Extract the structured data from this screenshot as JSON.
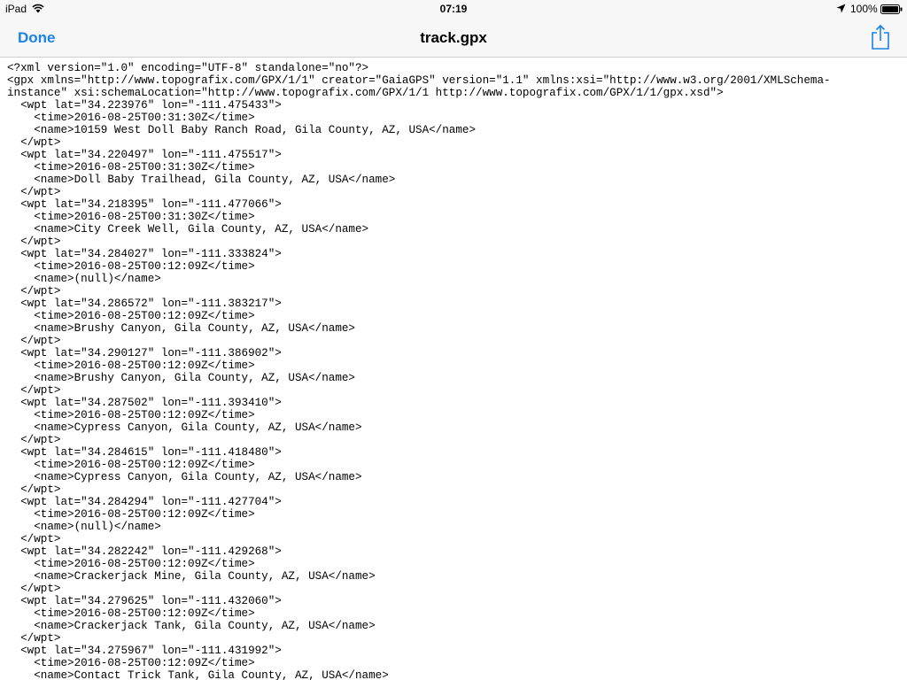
{
  "status_bar": {
    "carrier": "iPad",
    "time": "07:19",
    "battery": "100%"
  },
  "nav": {
    "done_label": "Done",
    "title": "track.gpx"
  },
  "icons": {
    "wifi": "wifi-icon",
    "location": "location-arrow-icon",
    "battery": "battery-icon",
    "share": "share-icon"
  },
  "colors": {
    "accent": "#1a82e8",
    "bar_background": "#f7f7f7"
  },
  "xml_lines": [
    "<?xml version=\"1.0\" encoding=\"UTF-8\" standalone=\"no\"?>",
    "<gpx xmlns=\"http://www.topografix.com/GPX/1/1\" creator=\"GaiaGPS\" version=\"1.1\" xmlns:xsi=\"http://www.w3.org/2001/XMLSchema-",
    "instance\" xsi:schemaLocation=\"http://www.topografix.com/GPX/1/1 http://www.topografix.com/GPX/1/1/gpx.xsd\">",
    "  <wpt lat=\"34.223976\" lon=\"-111.475433\">",
    "    <time>2016-08-25T00:31:30Z</time>",
    "    <name>10159 West Doll Baby Ranch Road, Gila County, AZ, USA</name>",
    "  </wpt>",
    "  <wpt lat=\"34.220497\" lon=\"-111.475517\">",
    "    <time>2016-08-25T00:31:30Z</time>",
    "    <name>Doll Baby Trailhead, Gila County, AZ, USA</name>",
    "  </wpt>",
    "  <wpt lat=\"34.218395\" lon=\"-111.477066\">",
    "    <time>2016-08-25T00:31:30Z</time>",
    "    <name>City Creek Well, Gila County, AZ, USA</name>",
    "  </wpt>",
    "  <wpt lat=\"34.284027\" lon=\"-111.333824\">",
    "    <time>2016-08-25T00:12:09Z</time>",
    "    <name>(null)</name>",
    "  </wpt>",
    "  <wpt lat=\"34.286572\" lon=\"-111.383217\">",
    "    <time>2016-08-25T00:12:09Z</time>",
    "    <name>Brushy Canyon, Gila County, AZ, USA</name>",
    "  </wpt>",
    "  <wpt lat=\"34.290127\" lon=\"-111.386902\">",
    "    <time>2016-08-25T00:12:09Z</time>",
    "    <name>Brushy Canyon, Gila County, AZ, USA</name>",
    "  </wpt>",
    "  <wpt lat=\"34.287502\" lon=\"-111.393410\">",
    "    <time>2016-08-25T00:12:09Z</time>",
    "    <name>Cypress Canyon, Gila County, AZ, USA</name>",
    "  </wpt>",
    "  <wpt lat=\"34.284615\" lon=\"-111.418480\">",
    "    <time>2016-08-25T00:12:09Z</time>",
    "    <name>Cypress Canyon, Gila County, AZ, USA</name>",
    "  </wpt>",
    "  <wpt lat=\"34.284294\" lon=\"-111.427704\">",
    "    <time>2016-08-25T00:12:09Z</time>",
    "    <name>(null)</name>",
    "  </wpt>",
    "  <wpt lat=\"34.282242\" lon=\"-111.429268\">",
    "    <time>2016-08-25T00:12:09Z</time>",
    "    <name>Crackerjack Mine, Gila County, AZ, USA</name>",
    "  </wpt>",
    "  <wpt lat=\"34.279625\" lon=\"-111.432060\">",
    "    <time>2016-08-25T00:12:09Z</time>",
    "    <name>Crackerjack Tank, Gila County, AZ, USA</name>",
    "  </wpt>",
    "  <wpt lat=\"34.275967\" lon=\"-111.431992\">",
    "    <time>2016-08-25T00:12:09Z</time>",
    "    <name>Contact Trick Tank, Gila County, AZ, USA</name>"
  ]
}
